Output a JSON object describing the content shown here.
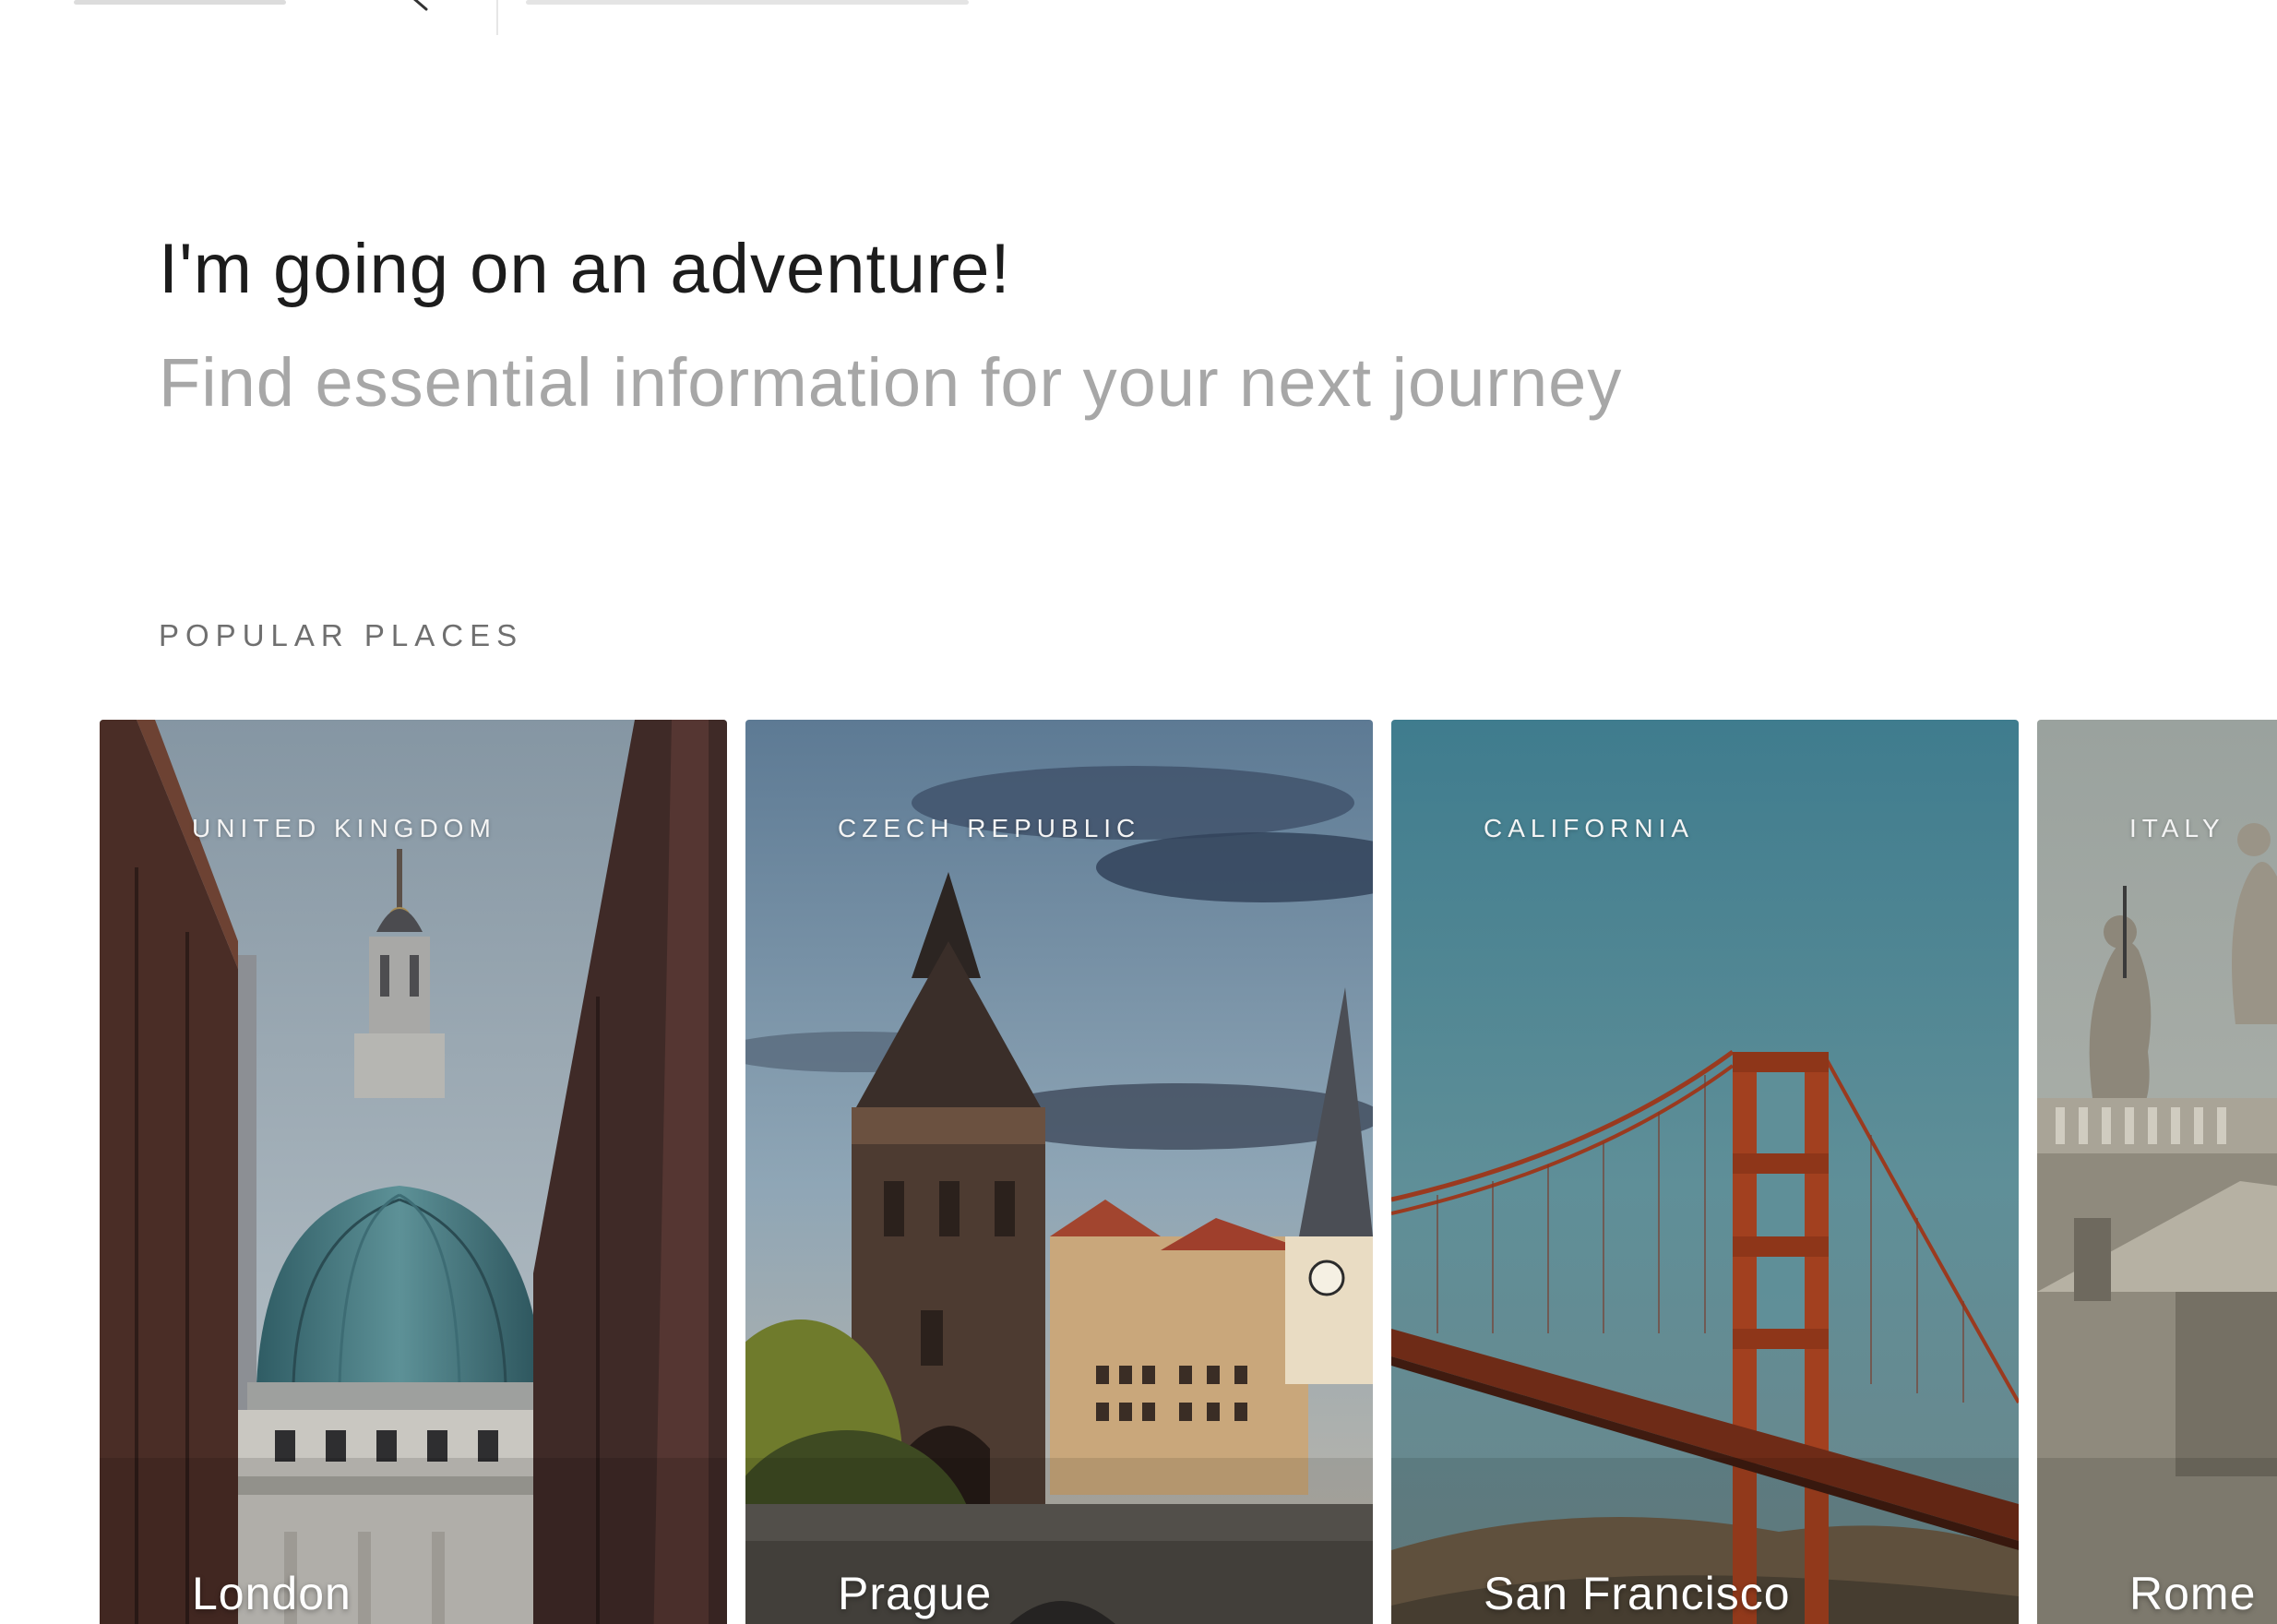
{
  "header": {
    "title": "I'm going on an adventure!",
    "subtitle": "Find essential information for your next journey"
  },
  "section": {
    "label": "POPULAR PLACES"
  },
  "places": [
    {
      "country": "UNITED KINGDOM",
      "city": "London",
      "image_icon": "st-pauls-cathedral"
    },
    {
      "country": "CZECH REPUBLIC",
      "city": "Prague",
      "image_icon": "charles-bridge-tower"
    },
    {
      "country": "CALIFORNIA",
      "city": "San Francisco",
      "image_icon": "golden-gate-bridge"
    },
    {
      "country": "ITALY",
      "city": "Rome",
      "image_icon": "vatican-statues"
    }
  ],
  "colors": {
    "title": "#1c1c1c",
    "subtitle": "#a7a7a7",
    "section_label": "#6f6f6f",
    "card_text": "#ffffff"
  }
}
